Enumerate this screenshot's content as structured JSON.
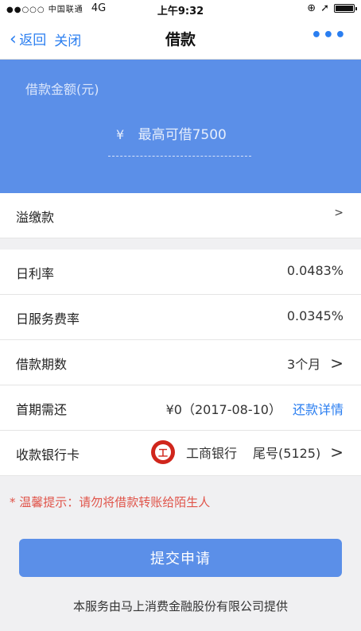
{
  "status_bar": {
    "carrier": "●●○○○ 中国联通",
    "network": "4G",
    "time": "上午9:32",
    "icons": [
      "orientation-lock-icon",
      "location-arrow-icon",
      "battery-icon"
    ]
  },
  "nav": {
    "back_label": "返回",
    "close_label": "关闭",
    "title": "借款",
    "more_label": "•••"
  },
  "loan": {
    "amount_label": "借款金额(元)",
    "currency_symbol": "¥",
    "amount_placeholder": "最高可借7500",
    "amount_value": ""
  },
  "overpayment": {
    "label": "溢缴款",
    "arrow": ">"
  },
  "details": {
    "daily_rate": {
      "label": "日利率",
      "value": "0.0483%"
    },
    "service_rate": {
      "label": "日服务费率",
      "value": "0.0345%"
    },
    "term": {
      "label": "借款期数",
      "value": "3个月",
      "arrow": ">"
    },
    "first_payment": {
      "label": "首期需还",
      "value": "¥0（2017-08-10）",
      "link": "还款详情"
    },
    "bank_card": {
      "label": "收款银行卡",
      "bank_name": "工商银行",
      "tail": "尾号(5125)",
      "arrow": ">",
      "logo_char": "工"
    }
  },
  "tip": "* 温馨提示：请勿将借款转账给陌生人",
  "submit_label": "提交申请",
  "footer": "本服务由马上消费金融股份有限公司提供",
  "colors": {
    "accent": "#2a7ef0",
    "hero_bg": "#5b8fe8",
    "warning": "#e0544a",
    "icbc_red": "#d0261c"
  }
}
